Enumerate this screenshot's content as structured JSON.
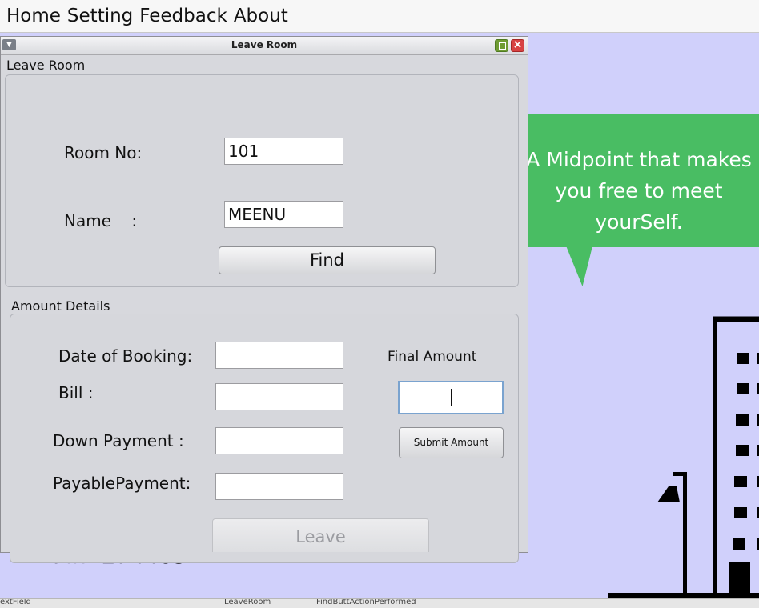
{
  "menu": {
    "home": "Home",
    "setting": "Setting",
    "feedback": "Feedback",
    "about": "About"
  },
  "background": {
    "bubble_line1": "A Midpoint that makes",
    "bubble_line2": "you free to meet",
    "bubble_line3": "yourSelf.",
    "pin": "Pin -274409",
    "bubble_color": "#49bd63",
    "bg_color": "#d0d0fb"
  },
  "window": {
    "title": "Leave Room",
    "group1_title": "Leave Room",
    "room_label": "Room No:",
    "room_value": "101",
    "name_label": "Name    :",
    "name_value": "MEENU",
    "find_label": "Find",
    "group2_title": "Amount Details",
    "booking_label": "Date of Booking:",
    "booking_value": "",
    "bill_label": "Bill :",
    "bill_value": "",
    "down_label": "Down Payment :",
    "down_value": "",
    "payable_label": "PayablePayment:",
    "payable_value": "",
    "final_label": "Final Amount",
    "final_value": "",
    "submit_label": "Submit Amount",
    "leave_label": "Leave"
  },
  "statusbar": {
    "item1": "extField",
    "item2": "LeaveRoom",
    "item3": "FindButtActionPerformed"
  }
}
